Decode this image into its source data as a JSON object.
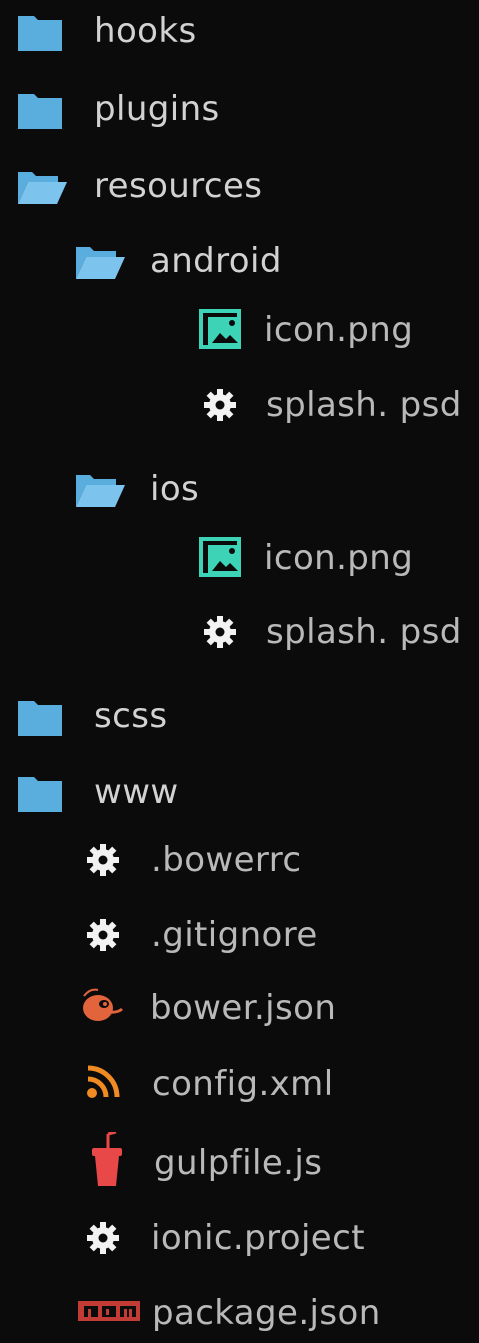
{
  "tree": {
    "items": [
      {
        "label": "hooks",
        "kind": "folder",
        "icon": "folder-closed"
      },
      {
        "label": "plugins",
        "kind": "folder",
        "icon": "folder-closed"
      },
      {
        "label": "resources",
        "kind": "folder",
        "icon": "folder-open"
      },
      {
        "label": "android",
        "kind": "folder",
        "icon": "folder-open"
      },
      {
        "label": "icon.png",
        "kind": "file",
        "icon": "image"
      },
      {
        "label": "splash. psd",
        "kind": "file",
        "icon": "gear"
      },
      {
        "label": "ios",
        "kind": "folder",
        "icon": "folder-open"
      },
      {
        "label": "icon.png",
        "kind": "file",
        "icon": "image"
      },
      {
        "label": "splash. psd",
        "kind": "file",
        "icon": "gear"
      },
      {
        "label": "scss",
        "kind": "folder",
        "icon": "folder-closed"
      },
      {
        "label": "www",
        "kind": "folder",
        "icon": "folder-closed"
      },
      {
        "label": ".bowerrc",
        "kind": "file",
        "icon": "gear"
      },
      {
        "label": ".gitignore",
        "kind": "file",
        "icon": "gear"
      },
      {
        "label": "bower.json",
        "kind": "file",
        "icon": "bower"
      },
      {
        "label": "config.xml",
        "kind": "file",
        "icon": "rss"
      },
      {
        "label": "gulpfile.js",
        "kind": "file",
        "icon": "gulp"
      },
      {
        "label": "ionic.project",
        "kind": "file",
        "icon": "gear"
      },
      {
        "label": "package.json",
        "kind": "file",
        "icon": "npm"
      }
    ]
  },
  "colors": {
    "background": "#0b0b0b",
    "folder": "#5aaede",
    "image_icon": "#3dd3b7",
    "gear_icon": "#f2f2f2",
    "bower_icon": "#e2643c",
    "rss_icon": "#f08a22",
    "gulp_icon": "#e84848",
    "npm_icon": "#c23b35"
  }
}
